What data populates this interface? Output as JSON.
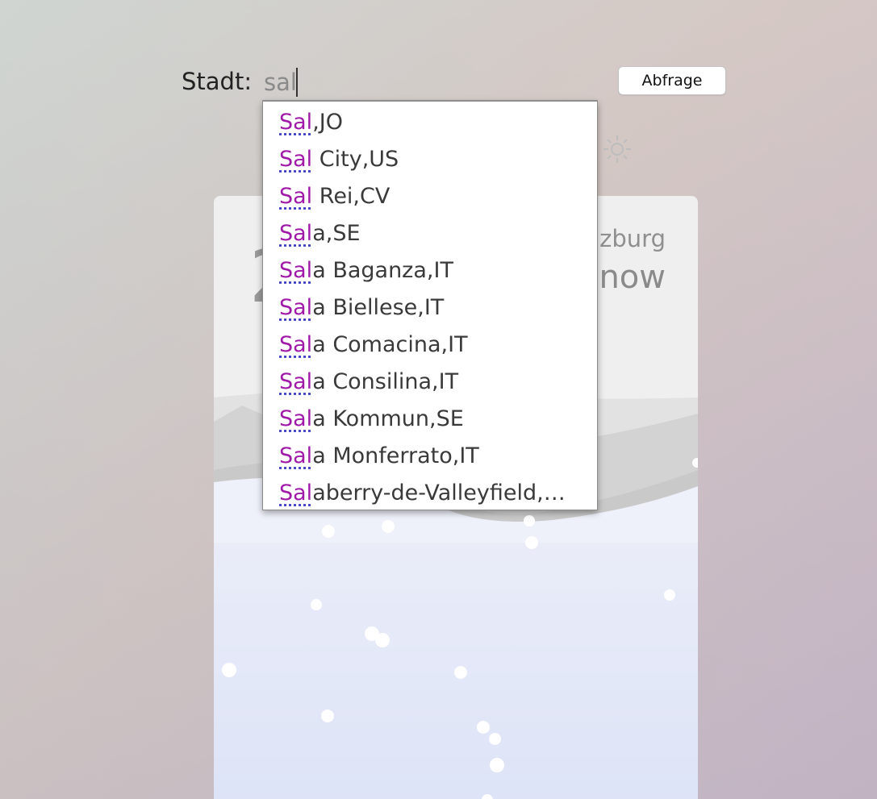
{
  "search": {
    "label": "Stadt:",
    "value": "sal",
    "button_label": "Abfrage"
  },
  "weather": {
    "temp_partial": "2",
    "city_partial": "lzburg",
    "condition_partial": "now",
    "icon": "sun-icon"
  },
  "autocomplete": {
    "highlight_color": "#a01aa8",
    "items": [
      {
        "match": "Sal",
        "rest": ",JO"
      },
      {
        "match": "Sal",
        "rest": " City,US"
      },
      {
        "match": "Sal",
        "rest": " Rei,CV"
      },
      {
        "match": "Sal",
        "rest": "a,SE"
      },
      {
        "match": "Sal",
        "rest": "a Baganza,IT"
      },
      {
        "match": "Sal",
        "rest": "a Biellese,IT"
      },
      {
        "match": "Sal",
        "rest": "a Comacina,IT"
      },
      {
        "match": "Sal",
        "rest": "a Consilina,IT"
      },
      {
        "match": "Sal",
        "rest": "a Kommun,SE"
      },
      {
        "match": "Sal",
        "rest": "a Monferrato,IT"
      },
      {
        "match": "Sal",
        "rest": "aberry-de-Valleyfield,…"
      }
    ]
  }
}
